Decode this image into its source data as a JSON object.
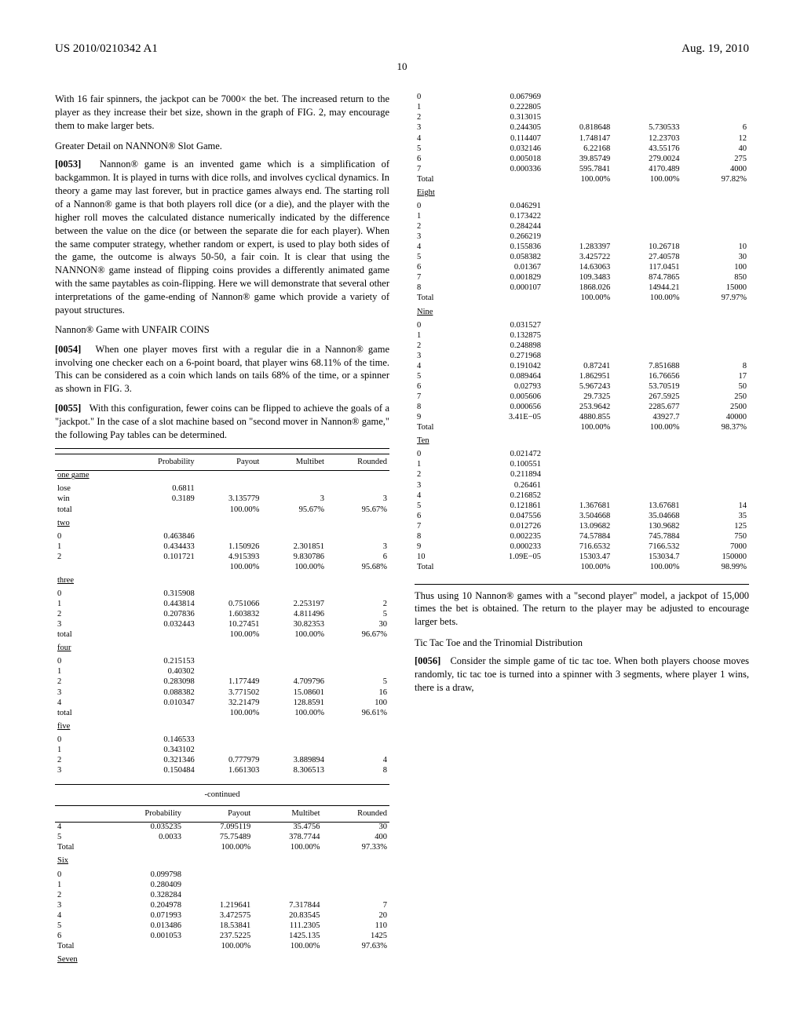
{
  "header": {
    "pubnum": "US 2010/0210342 A1",
    "date": "Aug. 19, 2010"
  },
  "pagenum": "10",
  "body": {
    "p1": "With 16 fair spinners, the jackpot can be 7000× the bet. The increased return to the player as they increase their bet size, shown in the graph of FIG. 2, may encourage them to make larger bets.",
    "h1": "Greater Detail on NANNON® Slot Game.",
    "p2n": "[0053]",
    "p2": "Nannon® game is an invented game which is a simplification of backgammon. It is played in turns with dice rolls, and involves cyclical dynamics. In theory a game may last forever, but in practice games always end. The starting roll of a Nannon® game is that both players roll dice (or a die), and the player with the higher roll moves the calculated distance numerically indicated by the difference between the value on the dice (or between the separate die for each player). When the same computer strategy, whether random or expert, is used to play both sides of the game, the outcome is always 50-50, a fair coin. It is clear that using the NANNON® game instead of flipping coins provides a differently animated game with the same paytables as coin-flipping. Here we will demonstrate that several other interpretations of the game-ending of Nannon® game which provide a variety of payout structures.",
    "h2": "Nannon® Game with UNFAIR COINS",
    "p3n": "[0054]",
    "p3": "When one player moves first with a regular die in a Nannon® game involving one checker each on a 6-point board, that player wins 68.11% of the time. This can be considered as a coin which lands on tails 68% of the time, or a spinner as shown in FIG. 3.",
    "p4n": "[0055]",
    "p4": "With this configuration, fewer coins can be flipped to achieve the goals of a \"jackpot.\" In the case of a slot machine based on \"second mover in Nannon® game,\" the following Pay tables can be determined.",
    "tbl1_head": [
      "",
      "Probability",
      "Payout",
      "Multibet",
      "Rounded"
    ],
    "tbl2_title": "-continued",
    "p5": "Thus using 10 Nannon® games with a \"second player\" model, a jackpot of 15,000 times the bet is obtained. The return to the player may be adjusted to encourage larger bets.",
    "h3": "Tic Tac Toe and the Trinomial Distribution",
    "p6n": "[0056]",
    "p6": "Consider the simple game of tic tac toe. When both players choose moves randomly, tic tac toe is turned into a spinner with 3 segments, where player 1 wins, there is a draw,"
  },
  "tbl1": {
    "groups": [
      {
        "name": "one game",
        "rows": [
          {
            "k": "lose",
            "p": "0.6811"
          },
          {
            "k": "win",
            "p": "0.3189",
            "pay": "3.135779",
            "mb": "3",
            "r": "3"
          },
          {
            "k": "total",
            "p": "",
            "pay": "100.00%",
            "mb": "95.67%",
            "r": "95.67%"
          }
        ]
      },
      {
        "name": "two",
        "rows": [
          {
            "k": "0",
            "p": "0.463846"
          },
          {
            "k": "1",
            "p": "0.434433",
            "pay": "1.150926",
            "mb": "2.301851",
            "r": "3"
          },
          {
            "k": "2",
            "p": "0.101721",
            "pay": "4.915393",
            "mb": "9.830786",
            "r": "6"
          },
          {
            "k": "",
            "p": "",
            "pay": "100.00%",
            "mb": "100.00%",
            "r": "95.68%"
          }
        ]
      },
      {
        "name": "three",
        "rows": [
          {
            "k": "0",
            "p": "0.315908"
          },
          {
            "k": "1",
            "p": "0.443814",
            "pay": "0.751066",
            "mb": "2.253197",
            "r": "2"
          },
          {
            "k": "2",
            "p": "0.207836",
            "pay": "1.603832",
            "mb": "4.811496",
            "r": "5"
          },
          {
            "k": "3",
            "p": "0.032443",
            "pay": "10.27451",
            "mb": "30.82353",
            "r": "30"
          },
          {
            "k": "total",
            "p": "",
            "pay": "100.00%",
            "mb": "100.00%",
            "r": "96.67%"
          }
        ]
      },
      {
        "name": "four",
        "rows": [
          {
            "k": "0",
            "p": "0.215153"
          },
          {
            "k": "1",
            "p": "0.40302"
          },
          {
            "k": "2",
            "p": "0.283098",
            "pay": "1.177449",
            "mb": "4.709796",
            "r": "5"
          },
          {
            "k": "3",
            "p": "0.088382",
            "pay": "3.771502",
            "mb": "15.08601",
            "r": "16"
          },
          {
            "k": "4",
            "p": "0.010347",
            "pay": "32.21479",
            "mb": "128.8591",
            "r": "100"
          },
          {
            "k": "total",
            "p": "",
            "pay": "100.00%",
            "mb": "100.00%",
            "r": "96.61%"
          }
        ]
      },
      {
        "name": "five",
        "rows": [
          {
            "k": "0",
            "p": "0.146533"
          },
          {
            "k": "1",
            "p": "0.343102"
          },
          {
            "k": "2",
            "p": "0.321346",
            "pay": "0.777979",
            "mb": "3.889894",
            "r": "4"
          },
          {
            "k": "3",
            "p": "0.150484",
            "pay": "1.661303",
            "mb": "8.306513",
            "r": "8"
          }
        ]
      }
    ]
  },
  "tbl2": {
    "groups": [
      {
        "name": "",
        "rows": [
          {
            "k": "4",
            "p": "0.035235",
            "pay": "7.095119",
            "mb": "35.4756",
            "r": "30"
          },
          {
            "k": "5",
            "p": "0.0033",
            "pay": "75.75489",
            "mb": "378.7744",
            "r": "400"
          },
          {
            "k": "Total",
            "p": "",
            "pay": "100.00%",
            "mb": "100.00%",
            "r": "97.33%"
          }
        ]
      },
      {
        "name": "Six",
        "rows": [
          {
            "k": "0",
            "p": "0.099798"
          },
          {
            "k": "1",
            "p": "0.280409"
          },
          {
            "k": "2",
            "p": "0.328284"
          },
          {
            "k": "3",
            "p": "0.204978",
            "pay": "1.219641",
            "mb": "7.317844",
            "r": "7"
          },
          {
            "k": "4",
            "p": "0.071993",
            "pay": "3.472575",
            "mb": "20.83545",
            "r": "20"
          },
          {
            "k": "5",
            "p": "0.013486",
            "pay": "18.53841",
            "mb": "111.2305",
            "r": "110"
          },
          {
            "k": "6",
            "p": "0.001053",
            "pay": "237.5225",
            "mb": "1425.135",
            "r": "1425"
          },
          {
            "k": "Total",
            "p": "",
            "pay": "100.00%",
            "mb": "100.00%",
            "r": "97.63%"
          }
        ]
      },
      {
        "name": "Seven",
        "rows": [
          {
            "k": "0",
            "p": "0.067969"
          },
          {
            "k": "1",
            "p": "0.222805"
          },
          {
            "k": "2",
            "p": "0.313015"
          },
          {
            "k": "3",
            "p": "0.244305",
            "pay": "0.818648",
            "mb": "5.730533",
            "r": "6"
          },
          {
            "k": "4",
            "p": "0.114407",
            "pay": "1.748147",
            "mb": "12.23703",
            "r": "12"
          },
          {
            "k": "5",
            "p": "0.032146",
            "pay": "6.22168",
            "mb": "43.55176",
            "r": "40"
          },
          {
            "k": "6",
            "p": "0.005018",
            "pay": "39.85749",
            "mb": "279.0024",
            "r": "275"
          },
          {
            "k": "7",
            "p": "0.000336",
            "pay": "595.7841",
            "mb": "4170.489",
            "r": "4000"
          },
          {
            "k": "Total",
            "p": "",
            "pay": "100.00%",
            "mb": "100.00%",
            "r": "97.82%"
          }
        ]
      },
      {
        "name": "Eight",
        "rows": [
          {
            "k": "0",
            "p": "0.046291"
          },
          {
            "k": "1",
            "p": "0.173422"
          },
          {
            "k": "2",
            "p": "0.284244"
          },
          {
            "k": "3",
            "p": "0.266219"
          },
          {
            "k": "4",
            "p": "0.155836",
            "pay": "1.283397",
            "mb": "10.26718",
            "r": "10"
          },
          {
            "k": "5",
            "p": "0.058382",
            "pay": "3.425722",
            "mb": "27.40578",
            "r": "30"
          },
          {
            "k": "6",
            "p": "0.01367",
            "pay": "14.63063",
            "mb": "117.0451",
            "r": "100"
          },
          {
            "k": "7",
            "p": "0.001829",
            "pay": "109.3483",
            "mb": "874.7865",
            "r": "850"
          },
          {
            "k": "8",
            "p": "0.000107",
            "pay": "1868.026",
            "mb": "14944.21",
            "r": "15000"
          },
          {
            "k": "Total",
            "p": "",
            "pay": "100.00%",
            "mb": "100.00%",
            "r": "97.97%"
          }
        ]
      },
      {
        "name": "Nine",
        "rows": [
          {
            "k": "0",
            "p": "0.031527"
          },
          {
            "k": "1",
            "p": "0.132875"
          },
          {
            "k": "2",
            "p": "0.248898"
          },
          {
            "k": "3",
            "p": "0.271968"
          },
          {
            "k": "4",
            "p": "0.191042",
            "pay": "0.87241",
            "mb": "7.851688",
            "r": "8"
          },
          {
            "k": "5",
            "p": "0.089464",
            "pay": "1.862951",
            "mb": "16.76656",
            "r": "17"
          },
          {
            "k": "6",
            "p": "0.02793",
            "pay": "5.967243",
            "mb": "53.70519",
            "r": "50"
          },
          {
            "k": "7",
            "p": "0.005606",
            "pay": "29.7325",
            "mb": "267.5925",
            "r": "250"
          },
          {
            "k": "8",
            "p": "0.000656",
            "pay": "253.9642",
            "mb": "2285.677",
            "r": "2500"
          },
          {
            "k": "9",
            "p": "3.41E−05",
            "pay": "4880.855",
            "mb": "43927.7",
            "r": "40000"
          },
          {
            "k": "Total",
            "p": "",
            "pay": "100.00%",
            "mb": "100.00%",
            "r": "98.37%"
          }
        ]
      },
      {
        "name": "Ten",
        "rows": [
          {
            "k": "0",
            "p": "0.021472"
          },
          {
            "k": "1",
            "p": "0.100551"
          },
          {
            "k": "2",
            "p": "0.211894"
          },
          {
            "k": "3",
            "p": "0.26461"
          },
          {
            "k": "4",
            "p": "0.216852"
          },
          {
            "k": "5",
            "p": "0.121861",
            "pay": "1.367681",
            "mb": "13.67681",
            "r": "14"
          },
          {
            "k": "6",
            "p": "0.047556",
            "pay": "3.504668",
            "mb": "35.04668",
            "r": "35"
          },
          {
            "k": "7",
            "p": "0.012726",
            "pay": "13.09682",
            "mb": "130.9682",
            "r": "125"
          },
          {
            "k": "8",
            "p": "0.002235",
            "pay": "74.57884",
            "mb": "745.7884",
            "r": "750"
          },
          {
            "k": "9",
            "p": "0.000233",
            "pay": "716.6532",
            "mb": "7166.532",
            "r": "7000"
          },
          {
            "k": "10",
            "p": "1.09E−05",
            "pay": "15303.47",
            "mb": "153034.7",
            "r": "150000"
          },
          {
            "k": "Total",
            "p": "",
            "pay": "100.00%",
            "mb": "100.00%",
            "r": "98.99%"
          }
        ]
      }
    ]
  }
}
